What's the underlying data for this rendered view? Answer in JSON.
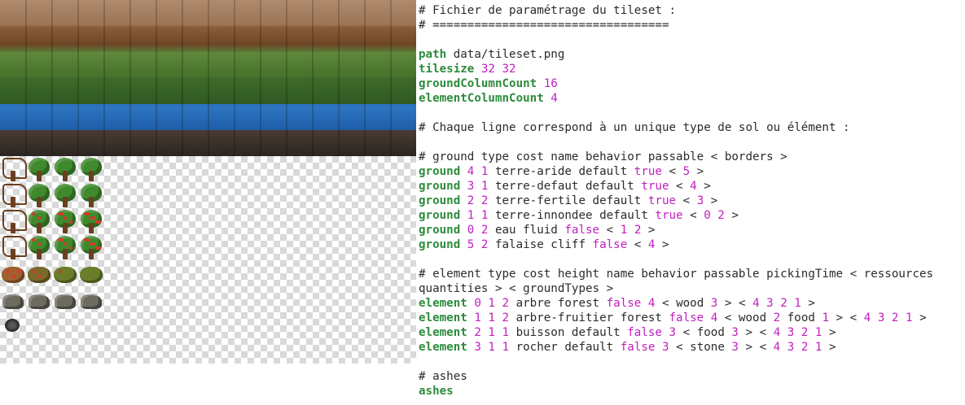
{
  "window": {
    "title": ""
  },
  "tileset_preview": {
    "ground_rows": [
      "terre-aride",
      "terre-defaut",
      "terre-fertile",
      "terre-innondee",
      "eau",
      "falaise"
    ],
    "element_rows": [
      "arbre",
      "arbre-fruitier",
      "buisson",
      "rocher",
      "ashes"
    ],
    "icons": [
      "dead-tree-icon",
      "tree-icon",
      "fruit-tree-icon",
      "bush-icon",
      "rock-icon",
      "ash-icon"
    ]
  },
  "editor": {
    "lines": [
      [
        {
          "t": "# Fichier de paramétrage du tileset :",
          "c": "plain"
        }
      ],
      [
        {
          "t": "# ==================================",
          "c": "plain"
        }
      ],
      [],
      [
        {
          "t": "path",
          "c": "kw"
        },
        {
          "t": " data/tileset.png",
          "c": "plain"
        }
      ],
      [
        {
          "t": "tilesize",
          "c": "kw"
        },
        {
          "t": " 32 32",
          "c": "num"
        }
      ],
      [
        {
          "t": "groundColumnCount",
          "c": "kw"
        },
        {
          "t": " 16",
          "c": "num"
        }
      ],
      [
        {
          "t": "elementColumnCount",
          "c": "kw"
        },
        {
          "t": " 4",
          "c": "num"
        }
      ],
      [],
      [
        {
          "t": "# Chaque ligne correspond à un unique type de sol ou élément :",
          "c": "plain"
        }
      ],
      [],
      [
        {
          "t": "# ground type cost name behavior passable < borders >",
          "c": "plain"
        }
      ],
      [
        {
          "t": "ground",
          "c": "kw"
        },
        {
          "t": " 4 1",
          "c": "num"
        },
        {
          "t": " terre-aride default ",
          "c": "plain"
        },
        {
          "t": "true",
          "c": "bool"
        },
        {
          "t": " < ",
          "c": "plain"
        },
        {
          "t": "5",
          "c": "num"
        },
        {
          "t": " >",
          "c": "plain"
        }
      ],
      [
        {
          "t": "ground",
          "c": "kw"
        },
        {
          "t": " 3 1",
          "c": "num"
        },
        {
          "t": " terre-defaut default ",
          "c": "plain"
        },
        {
          "t": "true",
          "c": "bool"
        },
        {
          "t": " < ",
          "c": "plain"
        },
        {
          "t": "4",
          "c": "num"
        },
        {
          "t": " >",
          "c": "plain"
        }
      ],
      [
        {
          "t": "ground",
          "c": "kw"
        },
        {
          "t": " 2 2",
          "c": "num"
        },
        {
          "t": " terre-fertile default ",
          "c": "plain"
        },
        {
          "t": "true",
          "c": "bool"
        },
        {
          "t": " < ",
          "c": "plain"
        },
        {
          "t": "3",
          "c": "num"
        },
        {
          "t": " >",
          "c": "plain"
        }
      ],
      [
        {
          "t": "ground",
          "c": "kw"
        },
        {
          "t": " 1 1",
          "c": "num"
        },
        {
          "t": " terre-innondee default ",
          "c": "plain"
        },
        {
          "t": "true",
          "c": "bool"
        },
        {
          "t": " < ",
          "c": "plain"
        },
        {
          "t": "0 2",
          "c": "num"
        },
        {
          "t": " >",
          "c": "plain"
        }
      ],
      [
        {
          "t": "ground",
          "c": "kw"
        },
        {
          "t": " 0 2",
          "c": "num"
        },
        {
          "t": " eau fluid ",
          "c": "plain"
        },
        {
          "t": "false",
          "c": "bool"
        },
        {
          "t": " < ",
          "c": "plain"
        },
        {
          "t": "1 2",
          "c": "num"
        },
        {
          "t": " >",
          "c": "plain"
        }
      ],
      [
        {
          "t": "ground",
          "c": "kw"
        },
        {
          "t": " 5 2",
          "c": "num"
        },
        {
          "t": " falaise cliff ",
          "c": "plain"
        },
        {
          "t": "false",
          "c": "bool"
        },
        {
          "t": " < ",
          "c": "plain"
        },
        {
          "t": "4",
          "c": "num"
        },
        {
          "t": " >",
          "c": "plain"
        }
      ],
      [],
      [
        {
          "t": "# element type cost height name behavior passable pickingTime < ressources",
          "c": "plain"
        }
      ],
      [
        {
          "t": "quantities > < groundTypes >",
          "c": "plain"
        }
      ],
      [
        {
          "t": "element",
          "c": "kw"
        },
        {
          "t": " 0 1 2",
          "c": "num"
        },
        {
          "t": " arbre forest ",
          "c": "plain"
        },
        {
          "t": "false",
          "c": "bool"
        },
        {
          "t": " 4",
          "c": "num"
        },
        {
          "t": " < wood ",
          "c": "plain"
        },
        {
          "t": "3",
          "c": "num"
        },
        {
          "t": " > < ",
          "c": "plain"
        },
        {
          "t": "4 3 2 1",
          "c": "num"
        },
        {
          "t": " >",
          "c": "plain"
        }
      ],
      [
        {
          "t": "element",
          "c": "kw"
        },
        {
          "t": " 1 1 2",
          "c": "num"
        },
        {
          "t": " arbre-fruitier forest ",
          "c": "plain"
        },
        {
          "t": "false",
          "c": "bool"
        },
        {
          "t": " 4",
          "c": "num"
        },
        {
          "t": " < wood ",
          "c": "plain"
        },
        {
          "t": "2",
          "c": "num"
        },
        {
          "t": " food ",
          "c": "plain"
        },
        {
          "t": "1",
          "c": "num"
        },
        {
          "t": " > < ",
          "c": "plain"
        },
        {
          "t": "4 3 2 1",
          "c": "num"
        },
        {
          "t": " >",
          "c": "plain"
        }
      ],
      [
        {
          "t": "element",
          "c": "kw"
        },
        {
          "t": " 2 1 1",
          "c": "num"
        },
        {
          "t": " buisson default ",
          "c": "plain"
        },
        {
          "t": "false",
          "c": "bool"
        },
        {
          "t": " 3",
          "c": "num"
        },
        {
          "t": " < food ",
          "c": "plain"
        },
        {
          "t": "3",
          "c": "num"
        },
        {
          "t": " > < ",
          "c": "plain"
        },
        {
          "t": "4 3 2 1",
          "c": "num"
        },
        {
          "t": " >",
          "c": "plain"
        }
      ],
      [
        {
          "t": "element",
          "c": "kw"
        },
        {
          "t": " 3 1 1",
          "c": "num"
        },
        {
          "t": " rocher default ",
          "c": "plain"
        },
        {
          "t": "false",
          "c": "bool"
        },
        {
          "t": " 3",
          "c": "num"
        },
        {
          "t": " < stone ",
          "c": "plain"
        },
        {
          "t": "3",
          "c": "num"
        },
        {
          "t": " > < ",
          "c": "plain"
        },
        {
          "t": "4 3 2 1",
          "c": "num"
        },
        {
          "t": " >",
          "c": "plain"
        }
      ],
      [],
      [
        {
          "t": "# ashes",
          "c": "plain"
        }
      ],
      [
        {
          "t": "ashes",
          "c": "kw"
        }
      ]
    ]
  }
}
